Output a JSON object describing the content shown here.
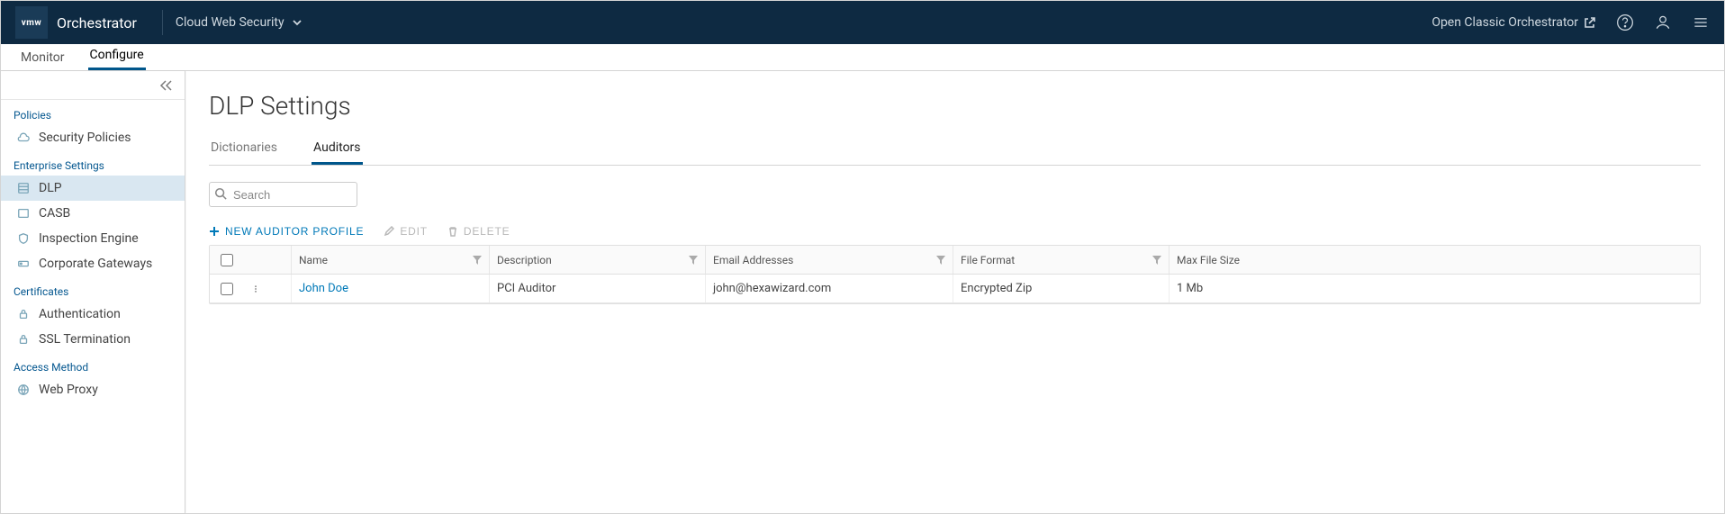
{
  "brand": {
    "logo_text": "vmw",
    "title": "Orchestrator"
  },
  "context": {
    "name": "Cloud Web Security"
  },
  "topbar": {
    "classic_link": "Open Classic Orchestrator"
  },
  "secondary_tabs": {
    "monitor": "Monitor",
    "configure": "Configure"
  },
  "sidebar": {
    "sections": {
      "policies": {
        "title": "Policies",
        "items": [
          {
            "label": "Security Policies",
            "icon": "cloud"
          }
        ]
      },
      "enterprise": {
        "title": "Enterprise Settings",
        "items": [
          {
            "label": "DLP",
            "icon": "grid",
            "active": true
          },
          {
            "label": "CASB",
            "icon": "tile"
          },
          {
            "label": "Inspection Engine",
            "icon": "shield"
          },
          {
            "label": "Corporate Gateways",
            "icon": "gateway"
          }
        ]
      },
      "certificates": {
        "title": "Certificates",
        "items": [
          {
            "label": "Authentication",
            "icon": "lock"
          },
          {
            "label": "SSL Termination",
            "icon": "lock"
          }
        ]
      },
      "access": {
        "title": "Access Method",
        "items": [
          {
            "label": "Web Proxy",
            "icon": "proxy"
          }
        ]
      }
    }
  },
  "page": {
    "title": "DLP Settings",
    "tabs": {
      "dictionaries": "Dictionaries",
      "auditors": "Auditors"
    },
    "search": {
      "placeholder": "Search"
    },
    "actions": {
      "new_profile": "NEW AUDITOR PROFILE",
      "edit": "EDIT",
      "delete": "DELETE"
    },
    "columns": {
      "name": "Name",
      "description": "Description",
      "email": "Email Addresses",
      "format": "File Format",
      "max_size": "Max File Size"
    },
    "rows": [
      {
        "name": "John Doe",
        "description": "PCI Auditor",
        "email": "john@hexawizard.com",
        "format": "Encrypted Zip",
        "max_size": "1 Mb"
      }
    ]
  }
}
